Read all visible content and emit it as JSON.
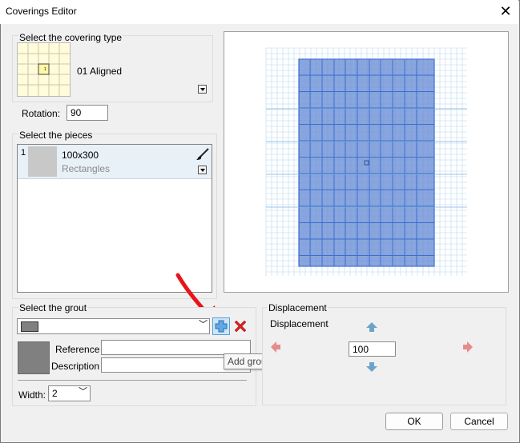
{
  "window": {
    "title": "Coverings Editor"
  },
  "covering_type": {
    "group_label": "Select the covering type",
    "selected_name": "01 Aligned",
    "thumb_number": "1",
    "rotation_label": "Rotation:",
    "rotation_value": "90"
  },
  "pieces": {
    "group_label": "Select the pieces",
    "items": [
      {
        "index": "1",
        "name": "100x300",
        "shape": "Rectangles"
      }
    ]
  },
  "grout": {
    "group_label": "Select the grout",
    "reference_label": "Reference",
    "description_label": "Description",
    "reference_value": "",
    "description_value": "",
    "width_label": "Width:",
    "width_value": "2",
    "add_tooltip": "Add grout...",
    "swatch_color": "#808080"
  },
  "displacement": {
    "group_label": "Displacement",
    "label": "Displacement",
    "value": "100"
  },
  "buttons": {
    "ok": "OK",
    "cancel": "Cancel"
  },
  "colors": {
    "annotation_arrow": "#e8141a",
    "tile_fill": "#6b8fd6",
    "tile_line": "#3a6fd0",
    "grid_line": "#b8d7ee",
    "arrow_blue": "#6ba4c9",
    "arrow_red": "#e78a8a"
  }
}
